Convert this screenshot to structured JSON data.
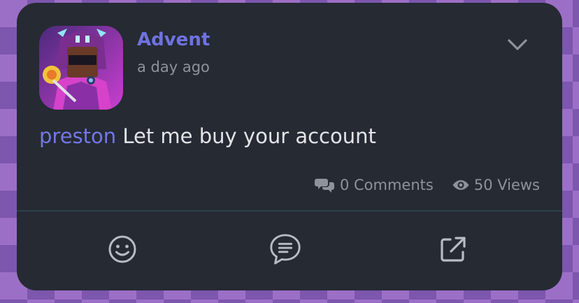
{
  "post": {
    "author": "Advent",
    "time": "a day ago",
    "mention": "preston",
    "text": " Let me buy your account",
    "comments": "0 Comments",
    "views": "50 Views"
  },
  "icons": {
    "menu": "chevron-down-icon",
    "comments": "comments-icon",
    "views": "eye-icon",
    "react": "smiley-icon",
    "comment": "chat-bubble-icon",
    "share": "external-link-icon"
  },
  "colors": {
    "card": "#252a33",
    "accent": "#6f72e0",
    "text": "#e2e4e8",
    "muted": "#8e939b"
  }
}
